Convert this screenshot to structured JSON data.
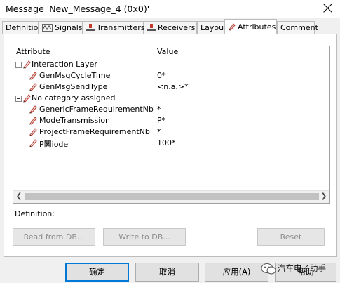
{
  "window": {
    "title": "Message 'New_Message_4 (0x0)'"
  },
  "tabs": [
    {
      "label": "Definition"
    },
    {
      "label": "Signals",
      "icon": "signals-icon"
    },
    {
      "label": "Transmitters",
      "icon": "transmitter-icon"
    },
    {
      "label": "Receivers",
      "icon": "receiver-icon"
    },
    {
      "label": "Layout"
    },
    {
      "label": "Attributes",
      "icon": "pen-icon",
      "active": true
    },
    {
      "label": "Comment"
    }
  ],
  "grid": {
    "col_attribute": "Attribute",
    "col_value": "Value",
    "groups": [
      {
        "label": "Interaction Layer",
        "rows": [
          {
            "name": "GenMsgCycleTime",
            "value": "0*"
          },
          {
            "name": "GenMsgSendType",
            "value": "<n.a.>*"
          }
        ]
      },
      {
        "label": "No category assigned",
        "rows": [
          {
            "name": "GenericFrameRequirementNb",
            "value": "*"
          },
          {
            "name": "ModeTransmission",
            "value": "P*"
          },
          {
            "name": "ProjectFrameRequirementNb",
            "value": "*"
          },
          {
            "name": "P闂iode",
            "value": "100*"
          }
        ]
      }
    ]
  },
  "definition": {
    "label": "Definition:",
    "read_btn": "Read from DB...",
    "write_btn": "Write to DB...",
    "reset_btn": "Reset"
  },
  "footer": {
    "ok": "确定",
    "cancel": "取消",
    "apply": "应用(A)",
    "help": "帮助"
  },
  "watermark": {
    "text": "汽车电子助手"
  },
  "colors": {
    "accent": "#0078d7",
    "pen": "#c0392b"
  }
}
